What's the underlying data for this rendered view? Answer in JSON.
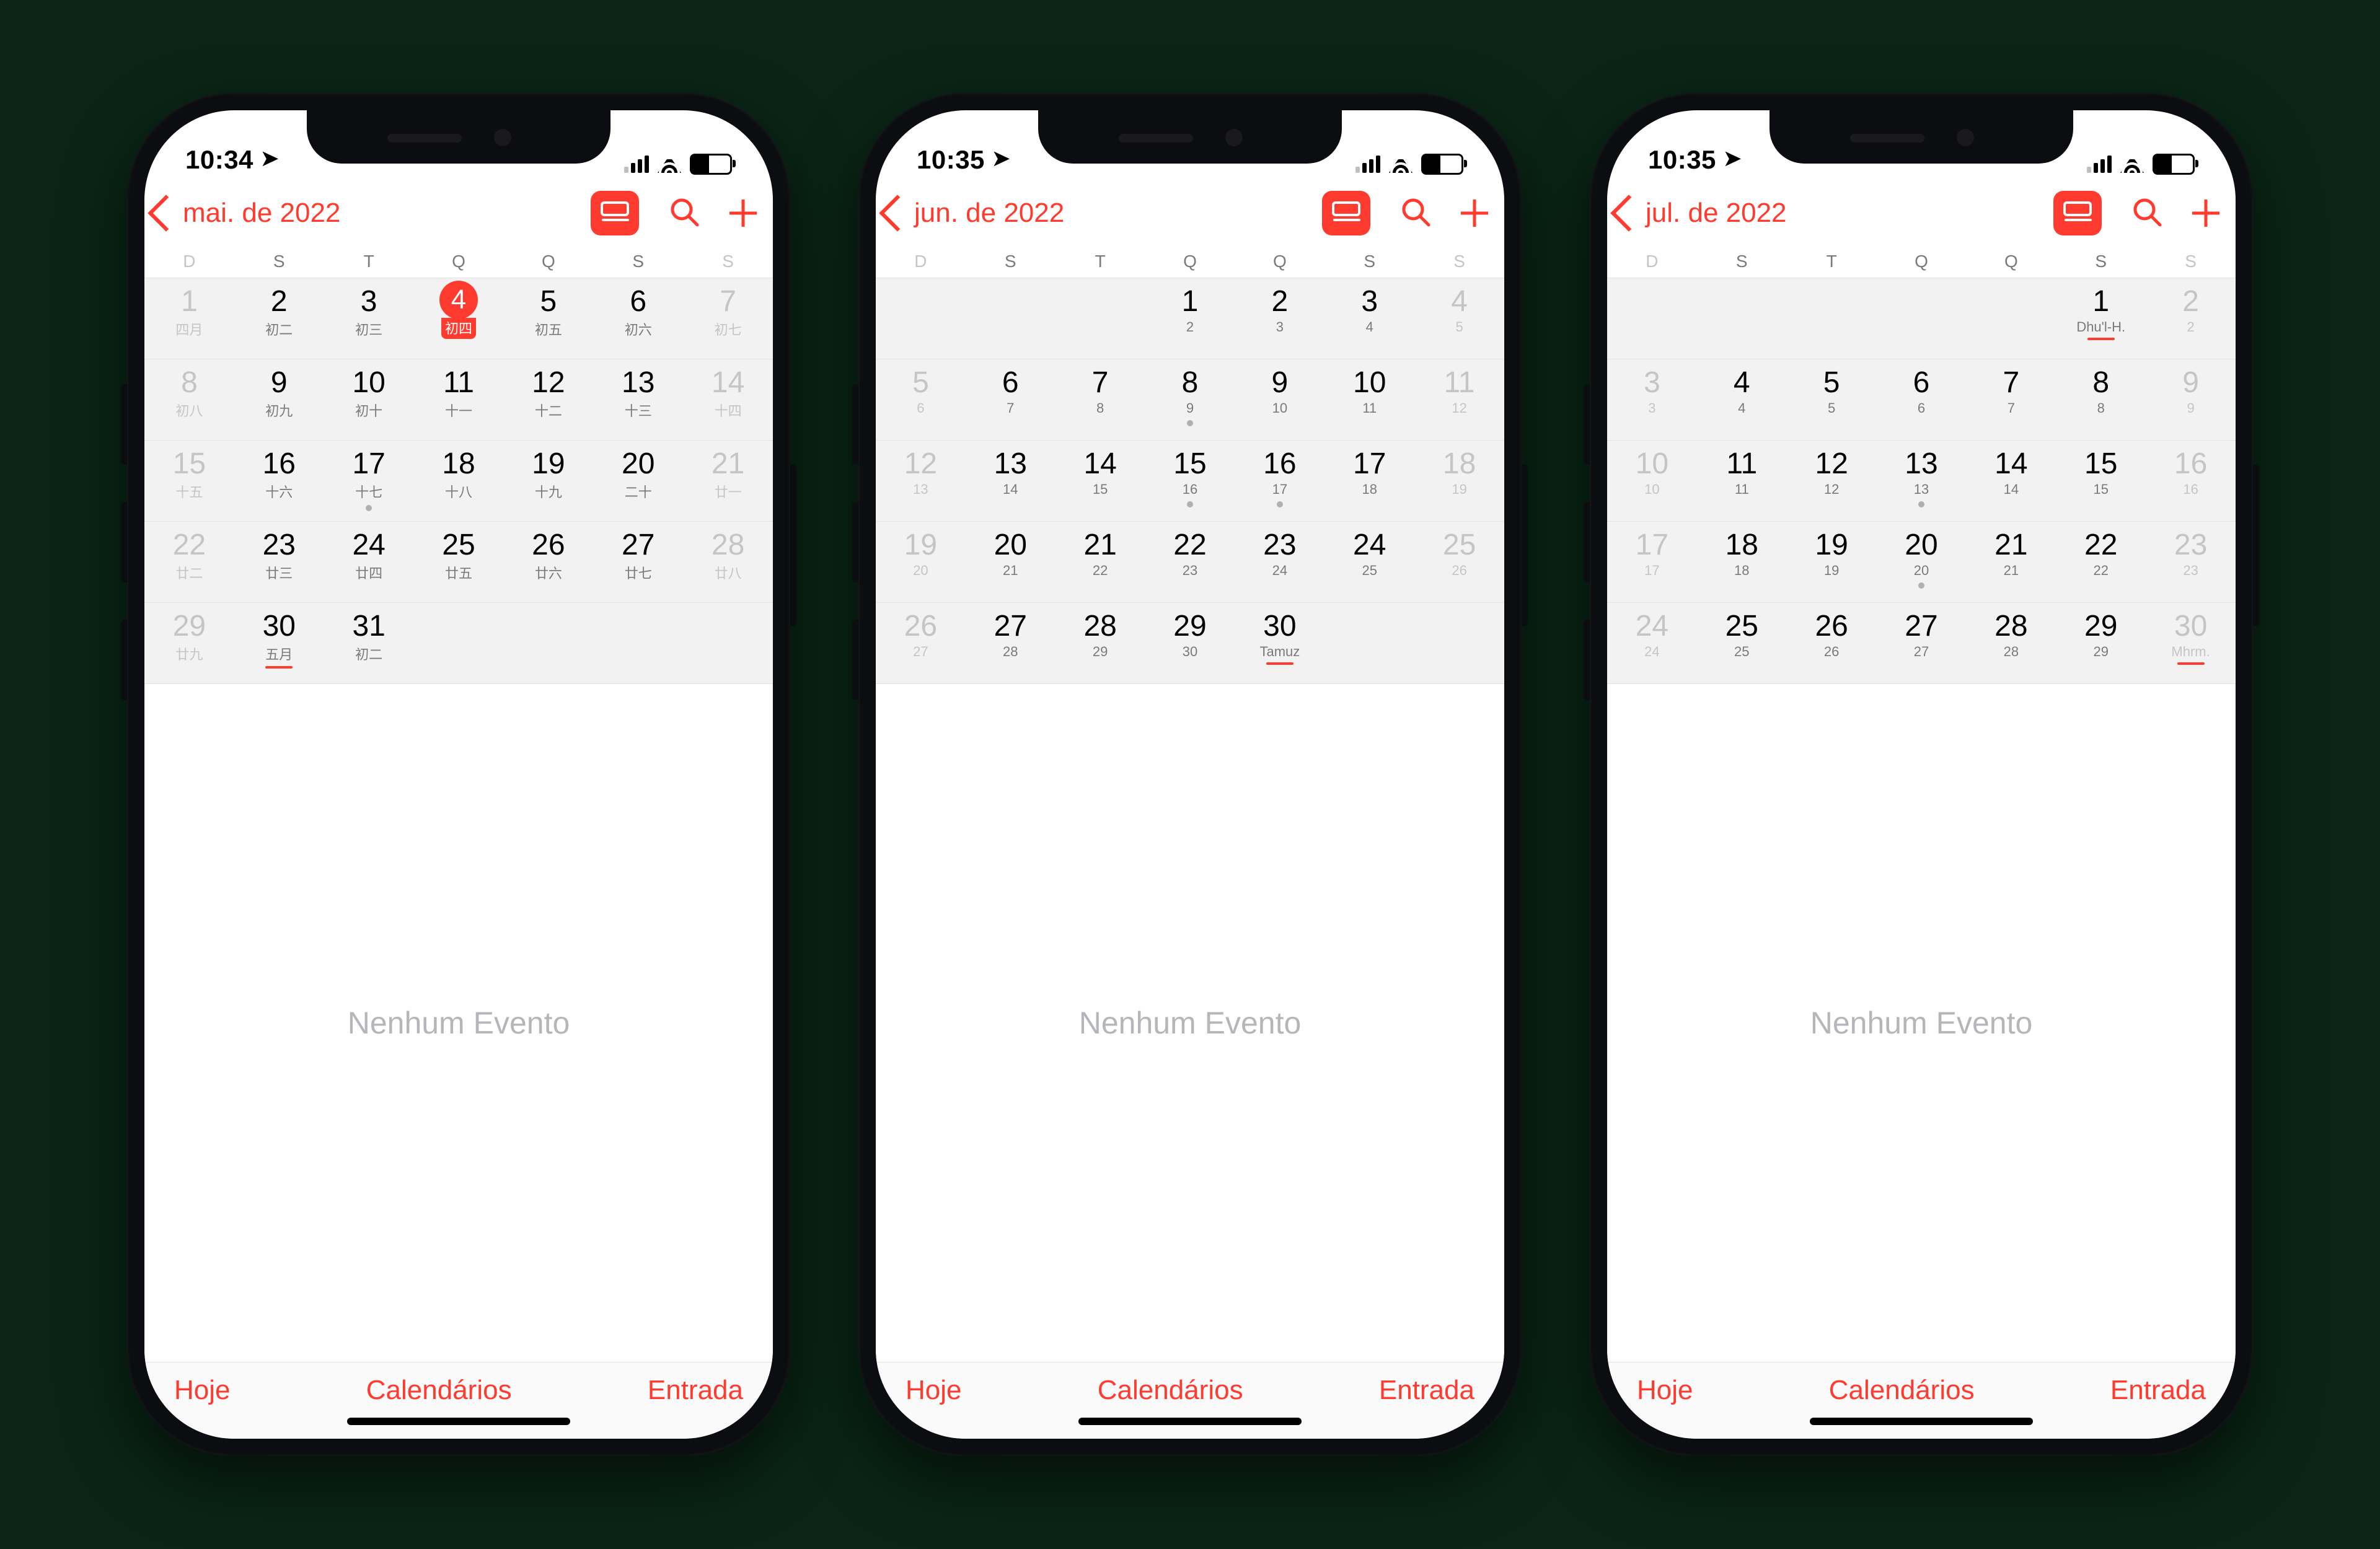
{
  "common": {
    "weekdays": [
      "D",
      "S",
      "T",
      "Q",
      "Q",
      "S",
      "S"
    ],
    "no_events": "Nenhum Evento",
    "toolbar": {
      "today": "Hoje",
      "calendars": "Calendários",
      "inbox": "Entrada"
    },
    "status": {
      "location_icon": "➤"
    }
  },
  "phones": [
    {
      "status_time": "10:34",
      "back_label": "mai. de 2022",
      "weeks": [
        [
          {
            "n": "1",
            "s": "四月",
            "weekend": true
          },
          {
            "n": "2",
            "s": "初二"
          },
          {
            "n": "3",
            "s": "初三"
          },
          {
            "n": "4",
            "s": "初四",
            "today": true
          },
          {
            "n": "5",
            "s": "初五"
          },
          {
            "n": "6",
            "s": "初六"
          },
          {
            "n": "7",
            "s": "初七",
            "weekend": true
          }
        ],
        [
          {
            "n": "8",
            "s": "初八",
            "weekend": true
          },
          {
            "n": "9",
            "s": "初九"
          },
          {
            "n": "10",
            "s": "初十"
          },
          {
            "n": "11",
            "s": "十一"
          },
          {
            "n": "12",
            "s": "十二"
          },
          {
            "n": "13",
            "s": "十三"
          },
          {
            "n": "14",
            "s": "十四",
            "weekend": true
          }
        ],
        [
          {
            "n": "15",
            "s": "十五",
            "weekend": true
          },
          {
            "n": "16",
            "s": "十六"
          },
          {
            "n": "17",
            "s": "十七",
            "dot": true
          },
          {
            "n": "18",
            "s": "十八"
          },
          {
            "n": "19",
            "s": "十九"
          },
          {
            "n": "20",
            "s": "二十"
          },
          {
            "n": "21",
            "s": "廿一",
            "weekend": true
          }
        ],
        [
          {
            "n": "22",
            "s": "廿二",
            "weekend": true
          },
          {
            "n": "23",
            "s": "廿三"
          },
          {
            "n": "24",
            "s": "廿四"
          },
          {
            "n": "25",
            "s": "廿五"
          },
          {
            "n": "26",
            "s": "廿六"
          },
          {
            "n": "27",
            "s": "廿七"
          },
          {
            "n": "28",
            "s": "廿八",
            "weekend": true
          }
        ],
        [
          {
            "n": "29",
            "s": "廿九",
            "weekend": true
          },
          {
            "n": "30",
            "s": "五月",
            "underline": true
          },
          {
            "n": "31",
            "s": "初二"
          },
          null,
          null,
          null,
          null
        ]
      ]
    },
    {
      "status_time": "10:35",
      "back_label": "jun. de 2022",
      "weeks": [
        [
          null,
          null,
          null,
          {
            "n": "1",
            "s": "2"
          },
          {
            "n": "2",
            "s": "3"
          },
          {
            "n": "3",
            "s": "4"
          },
          {
            "n": "4",
            "s": "5",
            "weekend": true
          }
        ],
        [
          {
            "n": "5",
            "s": "6",
            "weekend": true
          },
          {
            "n": "6",
            "s": "7"
          },
          {
            "n": "7",
            "s": "8"
          },
          {
            "n": "8",
            "s": "9",
            "dot": true
          },
          {
            "n": "9",
            "s": "10"
          },
          {
            "n": "10",
            "s": "11"
          },
          {
            "n": "11",
            "s": "12",
            "weekend": true
          }
        ],
        [
          {
            "n": "12",
            "s": "13",
            "weekend": true
          },
          {
            "n": "13",
            "s": "14"
          },
          {
            "n": "14",
            "s": "15"
          },
          {
            "n": "15",
            "s": "16",
            "dot": true
          },
          {
            "n": "16",
            "s": "17",
            "dot": true
          },
          {
            "n": "17",
            "s": "18"
          },
          {
            "n": "18",
            "s": "19",
            "weekend": true
          }
        ],
        [
          {
            "n": "19",
            "s": "20",
            "weekend": true
          },
          {
            "n": "20",
            "s": "21"
          },
          {
            "n": "21",
            "s": "22"
          },
          {
            "n": "22",
            "s": "23"
          },
          {
            "n": "23",
            "s": "24"
          },
          {
            "n": "24",
            "s": "25"
          },
          {
            "n": "25",
            "s": "26",
            "weekend": true
          }
        ],
        [
          {
            "n": "26",
            "s": "27",
            "weekend": true
          },
          {
            "n": "27",
            "s": "28"
          },
          {
            "n": "28",
            "s": "29"
          },
          {
            "n": "29",
            "s": "30"
          },
          {
            "n": "30",
            "s": "Tamuz",
            "underline": true
          },
          null,
          null
        ]
      ]
    },
    {
      "status_time": "10:35",
      "back_label": "jul. de 2022",
      "weeks": [
        [
          null,
          null,
          null,
          null,
          null,
          {
            "n": "1",
            "s": "Dhu'l-H.",
            "underline": true
          },
          {
            "n": "2",
            "s": "2",
            "weekend": true
          }
        ],
        [
          {
            "n": "3",
            "s": "3",
            "weekend": true
          },
          {
            "n": "4",
            "s": "4"
          },
          {
            "n": "5",
            "s": "5"
          },
          {
            "n": "6",
            "s": "6"
          },
          {
            "n": "7",
            "s": "7"
          },
          {
            "n": "8",
            "s": "8"
          },
          {
            "n": "9",
            "s": "9",
            "weekend": true
          }
        ],
        [
          {
            "n": "10",
            "s": "10",
            "weekend": true
          },
          {
            "n": "11",
            "s": "11"
          },
          {
            "n": "12",
            "s": "12"
          },
          {
            "n": "13",
            "s": "13",
            "dot": true
          },
          {
            "n": "14",
            "s": "14"
          },
          {
            "n": "15",
            "s": "15"
          },
          {
            "n": "16",
            "s": "16",
            "weekend": true
          }
        ],
        [
          {
            "n": "17",
            "s": "17",
            "weekend": true
          },
          {
            "n": "18",
            "s": "18"
          },
          {
            "n": "19",
            "s": "19"
          },
          {
            "n": "20",
            "s": "20",
            "dot": true
          },
          {
            "n": "21",
            "s": "21"
          },
          {
            "n": "22",
            "s": "22"
          },
          {
            "n": "23",
            "s": "23",
            "weekend": true
          }
        ],
        [
          {
            "n": "24",
            "s": "24",
            "weekend": true
          },
          {
            "n": "25",
            "s": "25"
          },
          {
            "n": "26",
            "s": "26"
          },
          {
            "n": "27",
            "s": "27"
          },
          {
            "n": "28",
            "s": "28"
          },
          {
            "n": "29",
            "s": "29"
          },
          {
            "n": "30",
            "s": "Mhrm.",
            "weekend": true,
            "underline": true
          }
        ]
      ]
    }
  ]
}
